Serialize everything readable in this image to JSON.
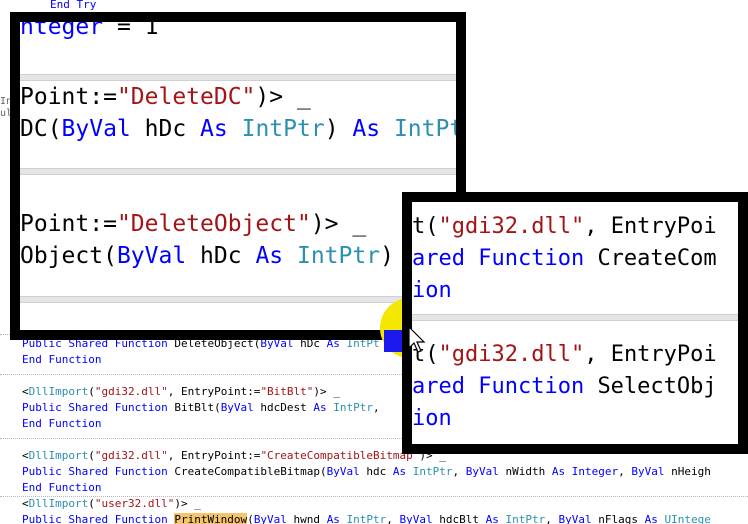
{
  "editor": {
    "top_fragment": "End Try",
    "left_fragments": [
      "Inc",
      "ult"
    ],
    "lines": [
      {
        "parts": [
          {
            "t": "Public Shared Function ",
            "c": "kw"
          },
          {
            "t": "DeleteObject(",
            "c": ""
          },
          {
            "t": "ByVal",
            "c": "kw"
          },
          {
            "t": " hDc ",
            "c": ""
          },
          {
            "t": "As",
            "c": "kw"
          },
          {
            "t": " IntPt",
            "c": "ty"
          }
        ]
      },
      {
        "parts": [
          {
            "t": "End Function",
            "c": "kw"
          }
        ]
      },
      {
        "parts": [
          {
            "t": "<",
            "c": ""
          },
          {
            "t": "DllImport",
            "c": "ty"
          },
          {
            "t": "(",
            "c": ""
          },
          {
            "t": "\"gdi32.dll\"",
            "c": "str"
          },
          {
            "t": ", EntryPoint:=",
            "c": ""
          },
          {
            "t": "\"BitBlt\"",
            "c": "str"
          },
          {
            "t": ")> _",
            "c": ""
          }
        ]
      },
      {
        "parts": [
          {
            "t": "Public Shared Function ",
            "c": "kw"
          },
          {
            "t": "BitBlt(",
            "c": ""
          },
          {
            "t": "ByVal",
            "c": "kw"
          },
          {
            "t": " hdcDest ",
            "c": ""
          },
          {
            "t": "As",
            "c": "kw"
          },
          {
            "t": " IntPtr",
            "c": "ty"
          },
          {
            "t": ",",
            "c": ""
          }
        ]
      },
      {
        "parts": [
          {
            "t": "End Function",
            "c": "kw"
          }
        ]
      },
      {
        "parts": [
          {
            "t": "<",
            "c": ""
          },
          {
            "t": "DllImport",
            "c": "ty"
          },
          {
            "t": "(",
            "c": ""
          },
          {
            "t": "\"gdi32.dll\"",
            "c": "str"
          },
          {
            "t": ", EntryPoint:=",
            "c": ""
          },
          {
            "t": "\"CreateCompatibleBitmap\"",
            "c": "str"
          },
          {
            "t": ")> _",
            "c": ""
          }
        ]
      },
      {
        "parts": [
          {
            "t": "Public Shared Function ",
            "c": "kw"
          },
          {
            "t": "CreateCompatibleBitmap(",
            "c": ""
          },
          {
            "t": "ByVal",
            "c": "kw"
          },
          {
            "t": " hdc ",
            "c": ""
          },
          {
            "t": "As",
            "c": "kw"
          },
          {
            "t": " IntPtr",
            "c": "ty"
          },
          {
            "t": ", ",
            "c": ""
          },
          {
            "t": "ByVal",
            "c": "kw"
          },
          {
            "t": " nWidth ",
            "c": ""
          },
          {
            "t": "As",
            "c": "kw"
          },
          {
            "t": " Integer",
            "c": "kw"
          },
          {
            "t": ", ",
            "c": ""
          },
          {
            "t": "ByVal",
            "c": "kw"
          },
          {
            "t": " nHeigh",
            "c": ""
          }
        ]
      },
      {
        "parts": [
          {
            "t": "End Function",
            "c": "kw"
          }
        ]
      },
      {
        "parts": [
          {
            "t": "<",
            "c": ""
          },
          {
            "t": "DllImport",
            "c": "ty"
          },
          {
            "t": "(",
            "c": ""
          },
          {
            "t": "\"user32.dll\"",
            "c": "str"
          },
          {
            "t": ")> _",
            "c": ""
          }
        ]
      },
      {
        "parts": [
          {
            "t": "Public Shared Function ",
            "c": "kw"
          },
          {
            "t": "PrintWindow",
            "c": "hl"
          },
          {
            "t": "(",
            "c": ""
          },
          {
            "t": "ByVal",
            "c": "kw"
          },
          {
            "t": " hwnd ",
            "c": ""
          },
          {
            "t": "As",
            "c": "kw"
          },
          {
            "t": " IntPtr",
            "c": "ty"
          },
          {
            "t": ", ",
            "c": ""
          },
          {
            "t": "ByVal",
            "c": "kw"
          },
          {
            "t": " hdcBlt ",
            "c": ""
          },
          {
            "t": "As",
            "c": "kw"
          },
          {
            "t": " IntPtr",
            "c": "ty"
          },
          {
            "t": ", ",
            "c": ""
          },
          {
            "t": "ByVal",
            "c": "kw"
          },
          {
            "t": " nFlags ",
            "c": ""
          },
          {
            "t": "As",
            "c": "kw"
          },
          {
            "t": " UIntege",
            "c": "ty"
          }
        ]
      }
    ]
  },
  "zoom1": {
    "lines": [
      {
        "parts": [
          {
            "t": "nteger",
            "c": "kw"
          },
          {
            "t": " = 1",
            "c": ""
          }
        ]
      },
      {
        "parts": [
          {
            "t": "Point:=",
            "c": ""
          },
          {
            "t": "\"DeleteDC\"",
            "c": "str"
          },
          {
            "t": ")> _",
            "c": ""
          }
        ]
      },
      {
        "parts": [
          {
            "t": "DC(",
            "c": ""
          },
          {
            "t": "ByVal",
            "c": "kw"
          },
          {
            "t": " hDc ",
            "c": ""
          },
          {
            "t": "As",
            "c": "kw"
          },
          {
            "t": " IntPtr",
            "c": "ty"
          },
          {
            "t": ") ",
            "c": ""
          },
          {
            "t": "As",
            "c": "kw"
          },
          {
            "t": " IntPt",
            "c": "ty"
          }
        ]
      },
      {
        "parts": [
          {
            "t": "Point:=",
            "c": ""
          },
          {
            "t": "\"DeleteObject\"",
            "c": "str"
          },
          {
            "t": ")> _",
            "c": ""
          }
        ]
      },
      {
        "parts": [
          {
            "t": "Object(",
            "c": ""
          },
          {
            "t": "ByVal",
            "c": "kw"
          },
          {
            "t": " hDc ",
            "c": ""
          },
          {
            "t": "As",
            "c": "kw"
          },
          {
            "t": " IntPtr",
            "c": "ty"
          },
          {
            "t": ")",
            "c": ""
          }
        ]
      }
    ]
  },
  "zoom2": {
    "lines": [
      {
        "parts": [
          {
            "t": "t(",
            "c": ""
          },
          {
            "t": "\"gdi32.dll\"",
            "c": "str"
          },
          {
            "t": ", EntryPoi",
            "c": ""
          }
        ]
      },
      {
        "parts": [
          {
            "t": "ared Function ",
            "c": "kw"
          },
          {
            "t": "CreateCom",
            "c": ""
          }
        ]
      },
      {
        "parts": [
          {
            "t": "ion",
            "c": "kw"
          }
        ]
      },
      {
        "parts": [
          {
            "t": "t(",
            "c": ""
          },
          {
            "t": "\"gdi32.dll\"",
            "c": "str"
          },
          {
            "t": ", EntryPoi",
            "c": ""
          }
        ]
      },
      {
        "parts": [
          {
            "t": "ared Function ",
            "c": "kw"
          },
          {
            "t": "SelectObj",
            "c": ""
          }
        ]
      },
      {
        "parts": [
          {
            "t": "ion",
            "c": "kw"
          }
        ]
      }
    ]
  }
}
